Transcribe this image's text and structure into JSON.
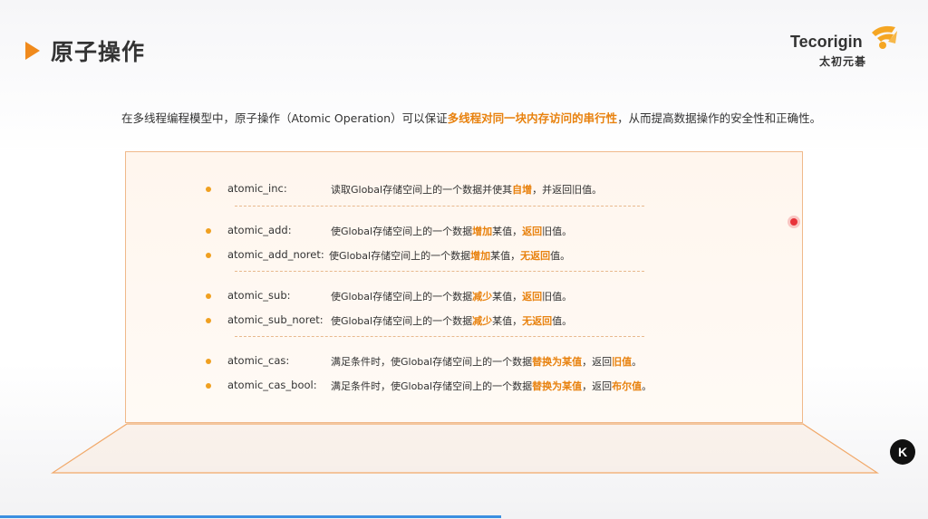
{
  "title": "原子操作",
  "logo": {
    "name_en": "Tecorigin",
    "name_cn": "太初元碁",
    "accent": "#f5a623"
  },
  "intro": {
    "prefix": "在多线程编程模型中，原子操作（Atomic Operation）可以保证",
    "highlight": "多线程对同一块内存访问的串行性",
    "suffix": "，从而提高数据操作的安全性和正确性。"
  },
  "items": [
    {
      "name": "atomic_inc:",
      "parts": [
        {
          "t": "读取Global存储空间上的一个数据并使其",
          "h": false
        },
        {
          "t": "自增",
          "h": true
        },
        {
          "t": "，并返回旧值。",
          "h": false
        }
      ]
    },
    {
      "name": "atomic_add:",
      "parts": [
        {
          "t": "使Global存储空间上的一个数据",
          "h": false
        },
        {
          "t": "增加",
          "h": true
        },
        {
          "t": "某值，",
          "h": false
        },
        {
          "t": "返回",
          "h": true
        },
        {
          "t": "旧值。",
          "h": false
        }
      ]
    },
    {
      "name": "atomic_add_noret:",
      "parts": [
        {
          "t": "使Global存储空间上的一个数据",
          "h": false
        },
        {
          "t": "增加",
          "h": true
        },
        {
          "t": "某值，",
          "h": false
        },
        {
          "t": "无返回",
          "h": true
        },
        {
          "t": "值。",
          "h": false
        }
      ]
    },
    {
      "name": "atomic_sub:",
      "parts": [
        {
          "t": "使Global存储空间上的一个数据",
          "h": false
        },
        {
          "t": "减少",
          "h": true
        },
        {
          "t": "某值，",
          "h": false
        },
        {
          "t": "返回",
          "h": true
        },
        {
          "t": "旧值。",
          "h": false
        }
      ]
    },
    {
      "name": "atomic_sub_noret:",
      "parts": [
        {
          "t": "使Global存储空间上的一个数据",
          "h": false
        },
        {
          "t": "减少",
          "h": true
        },
        {
          "t": "某值，",
          "h": false
        },
        {
          "t": "无返回",
          "h": true
        },
        {
          "t": "值。",
          "h": false
        }
      ]
    },
    {
      "name": "atomic_cas:",
      "parts": [
        {
          "t": "满足条件时，使Global存储空间上的一个数据",
          "h": false
        },
        {
          "t": "替换为某值",
          "h": true
        },
        {
          "t": "，返回",
          "h": false
        },
        {
          "t": "旧值",
          "h": true
        },
        {
          "t": "。",
          "h": false
        }
      ]
    },
    {
      "name": "atomic_cas_bool:",
      "parts": [
        {
          "t": "满足条件时，使Global存储空间上的一个数据",
          "h": false
        },
        {
          "t": "替换为某值",
          "h": true
        },
        {
          "t": "，返回",
          "h": false
        },
        {
          "t": "布尔值",
          "h": true
        },
        {
          "t": "。",
          "h": false
        }
      ]
    }
  ],
  "badge": "K",
  "colors": {
    "accent": "#f08a1c",
    "highlight": "#e8820f",
    "box_border": "#f0b98a"
  },
  "video_progress": 0.54
}
